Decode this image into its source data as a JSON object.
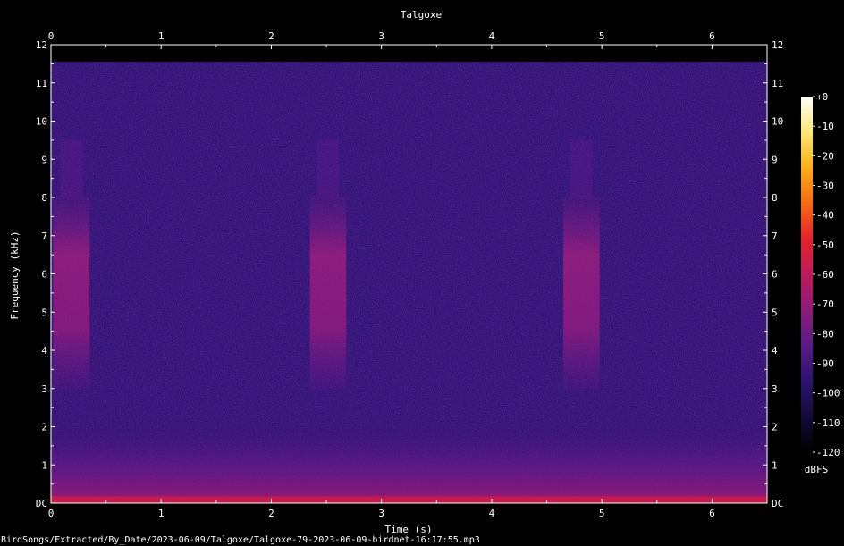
{
  "chart_data": {
    "type": "heatmap",
    "title": "Talgoxe",
    "xlabel": "Time (s)",
    "ylabel": "Frequency (kHz)",
    "xlim": [
      0,
      6.5
    ],
    "ylim": [
      0,
      12
    ],
    "x_ticks": [
      "0",
      "1",
      "2",
      "3",
      "4",
      "5",
      "6"
    ],
    "y_ticks": [
      "DC",
      "1",
      "2",
      "3",
      "4",
      "5",
      "6",
      "7",
      "8",
      "9",
      "10",
      "11",
      "12"
    ],
    "colorbar": {
      "label": "dBFS",
      "ticks": [
        "+0",
        "-10",
        "-20",
        "-30",
        "-40",
        "-50",
        "-60",
        "-70",
        "-80",
        "-90",
        "-100",
        "-110",
        "-120"
      ],
      "range": [
        -120,
        0
      ],
      "colors": [
        "#000000",
        "#120a3a",
        "#2c1273",
        "#5a1a8a",
        "#8e1a7a",
        "#c01a5a",
        "#e8202a",
        "#f86a10",
        "#fcae12",
        "#fde870",
        "#ffffff"
      ]
    },
    "calls": [
      {
        "start": 0.02,
        "end": 0.35,
        "low_khz": 3.0,
        "high_khz": 8.0,
        "level_dbfs": -72
      },
      {
        "start": 2.35,
        "end": 2.68,
        "low_khz": 3.0,
        "high_khz": 8.0,
        "level_dbfs": -72
      },
      {
        "start": 4.65,
        "end": 4.98,
        "low_khz": 3.0,
        "high_khz": 8.0,
        "level_dbfs": -72
      }
    ],
    "background_level_dbfs": -95,
    "low_band": {
      "high_khz": 1.0,
      "level_dbfs": -75
    },
    "dc_band_level_dbfs": -55,
    "source_file": "BirdSongs/Extracted/By_Date/2023-06-09/Talgoxe/Talgoxe-79-2023-06-09-birdnet-16:17:55.mp3"
  }
}
